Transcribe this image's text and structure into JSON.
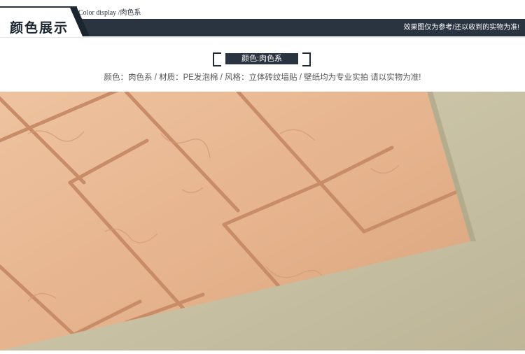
{
  "header": {
    "title": "颜色展示",
    "subtitle": "Color display /肉色系",
    "note": "效果图仅为参考/还以收到的实物为准!"
  },
  "color_tag": {
    "label": "颜色:肉色系"
  },
  "description": "颜色：肉色系 / 材质：PE发泡棉 / 风格：立体砖纹墙贴 / 壁纸均为专业实拍 请以实物为准!",
  "colors": {
    "header_bar": "#2a3440",
    "brick": "#e6b48e",
    "mortar": "#cf9470",
    "background_fabric": "#c9c2a3"
  }
}
